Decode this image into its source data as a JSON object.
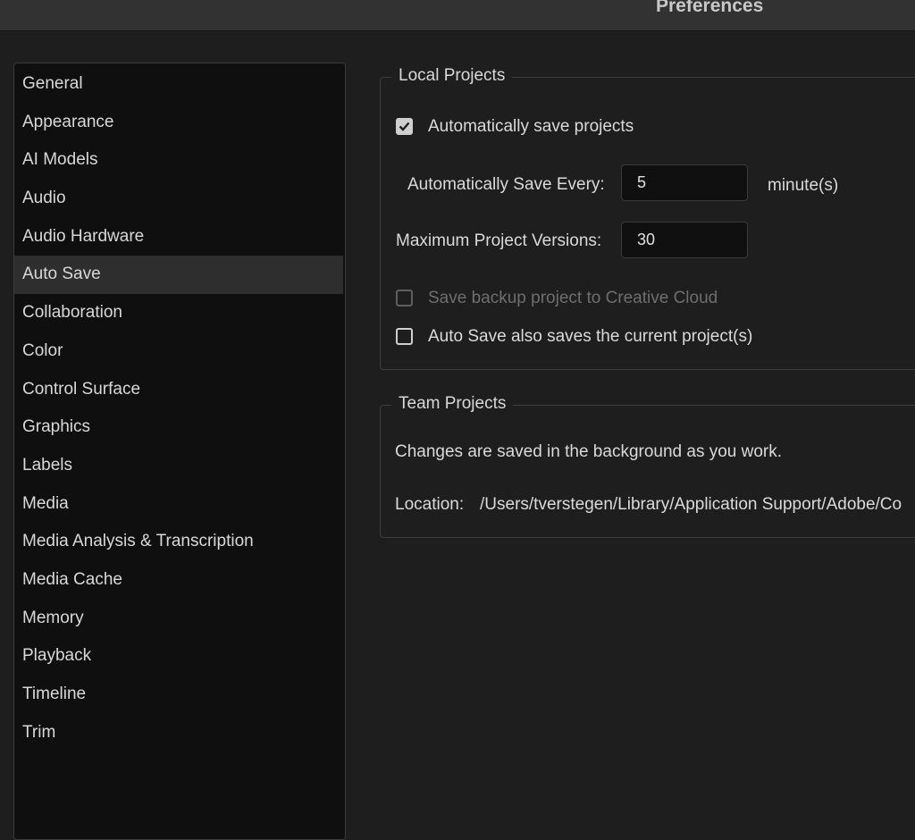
{
  "window": {
    "title": "Preferences"
  },
  "sidebar": {
    "items": [
      {
        "label": "General"
      },
      {
        "label": "Appearance"
      },
      {
        "label": "AI Models"
      },
      {
        "label": "Audio"
      },
      {
        "label": "Audio Hardware"
      },
      {
        "label": "Auto Save"
      },
      {
        "label": "Collaboration"
      },
      {
        "label": "Color"
      },
      {
        "label": "Control Surface"
      },
      {
        "label": "Graphics"
      },
      {
        "label": "Labels"
      },
      {
        "label": "Media"
      },
      {
        "label": "Media Analysis & Transcription"
      },
      {
        "label": "Media Cache"
      },
      {
        "label": "Memory"
      },
      {
        "label": "Playback"
      },
      {
        "label": "Timeline"
      },
      {
        "label": "Trim"
      }
    ],
    "selected": "Auto Save"
  },
  "local_projects": {
    "legend": "Local Projects",
    "auto_save_checkbox": {
      "label": "Automatically save projects",
      "checked": true
    },
    "save_every": {
      "label": "Automatically Save Every:",
      "value": "5",
      "unit": "minute(s)"
    },
    "max_versions": {
      "label": "Maximum Project Versions:",
      "value": "30"
    },
    "backup_checkbox": {
      "label": "Save backup project to Creative Cloud",
      "checked": false,
      "disabled": true
    },
    "current_project_checkbox": {
      "label": "Auto Save also saves the current project(s)",
      "checked": false
    }
  },
  "team_projects": {
    "legend": "Team Projects",
    "description": "Changes are saved in the background as you work.",
    "location_label": "Location:",
    "location_value": "/Users/tverstegen/Library/Application Support/Adobe/Co"
  },
  "colors": {
    "background": "#1e1e1e",
    "sidebar": "#0f0f0f",
    "selected": "#2e2e2e",
    "titlebar": "#323232"
  }
}
